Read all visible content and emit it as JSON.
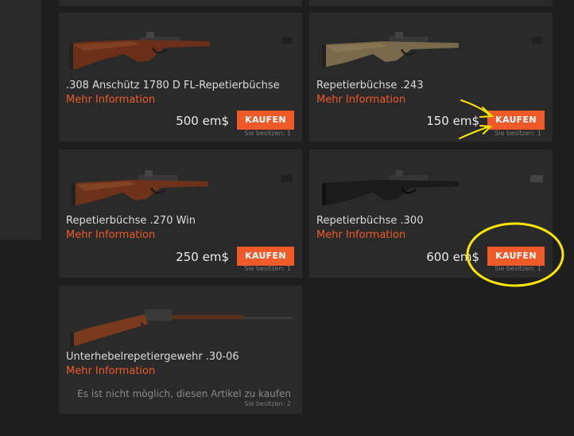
{
  "products": [
    {
      "name": ".308 Anschütz 1780 D FL-Repetierbüchse",
      "more_label": "Mehr Information",
      "price": "500 em$",
      "buy_label": "KAUFEN",
      "owned_label": "Sie besitzen: 1"
    },
    {
      "name": "Repetierbüchse .243",
      "more_label": "Mehr Information",
      "price": "150 em$",
      "buy_label": "KAUFEN",
      "owned_label": "Sie besitzen: 1"
    },
    {
      "name": "Repetierbüchse .270 Win",
      "more_label": "Mehr Information",
      "price": "250 em$",
      "buy_label": "KAUFEN",
      "owned_label": "Sie besitzen: 1"
    },
    {
      "name": "Repetierbüchse .300",
      "more_label": "Mehr Information",
      "price": "600 em$",
      "buy_label": "KAUFEN",
      "owned_label": "Sie besitzen: 1"
    },
    {
      "name": "Unterhebelrepetiergewehr .30-06",
      "more_label": "Mehr Information",
      "not_available": "Es ist nicht möglich, diesen Artikel zu kaufen",
      "owned_label": "Sie besitzen: 2"
    }
  ],
  "colors": {
    "accent": "#f05a28",
    "card": "#2a2a2a",
    "background": "#1e1e1e",
    "annotation": "#ffe600"
  }
}
